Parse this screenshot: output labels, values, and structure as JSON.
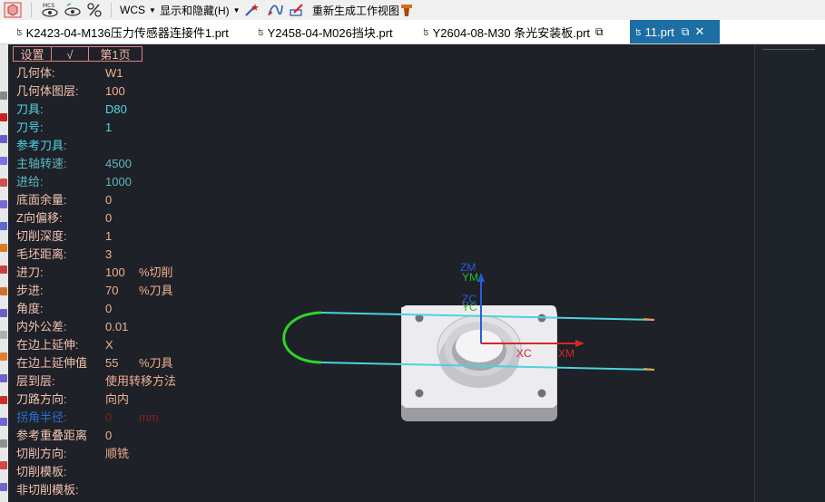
{
  "toolbar": {
    "wcs_label": "WCS",
    "show_hide_label": "显示和隐藏(H)",
    "regen_label": "重新生成工作视图"
  },
  "tabs": [
    {
      "label": "K2423-04-M136压力传感器连接件1.prt"
    },
    {
      "label": "Y2458-04-M026挡块.prt"
    },
    {
      "label": "Y2604-08-M30 条光安装板.prt"
    },
    {
      "label": "11.prt"
    }
  ],
  "panel": {
    "header": {
      "settings": "设置",
      "check": "√",
      "page": "第1页"
    },
    "rows": [
      {
        "label": "几何体:",
        "value": "W1",
        "unit": ""
      },
      {
        "label": "几何体图层:",
        "value": "100",
        "unit": ""
      },
      {
        "label": "刀具:",
        "value": "D80",
        "unit": ""
      },
      {
        "label": "刀号:",
        "value": "1",
        "unit": ""
      },
      {
        "label": "参考刀具:",
        "value": "",
        "unit": ""
      },
      {
        "label": "主轴转速:",
        "value": "4500",
        "unit": ""
      },
      {
        "label": "进给:",
        "value": "1000",
        "unit": ""
      },
      {
        "label": "底面余量:",
        "value": "0",
        "unit": ""
      },
      {
        "label": "Z向偏移:",
        "value": "0",
        "unit": ""
      },
      {
        "label": "切削深度:",
        "value": "1",
        "unit": ""
      },
      {
        "label": "毛坯距离:",
        "value": "3",
        "unit": ""
      },
      {
        "label": "进刀:",
        "value": "100",
        "unit": "%切削"
      },
      {
        "label": "步进:",
        "value": "70",
        "unit": "%刀具"
      },
      {
        "label": "角度:",
        "value": "0",
        "unit": ""
      },
      {
        "label": "内外公差:",
        "value": "0.01",
        "unit": ""
      },
      {
        "label": "在边上延伸:",
        "value": "X",
        "unit": ""
      },
      {
        "label": "在边上延伸值",
        "value": "55",
        "unit": "%刀具"
      },
      {
        "label": "层到层:",
        "value": "使用转移方法",
        "unit": ""
      },
      {
        "label": "刀路方向:",
        "value": "向内",
        "unit": ""
      },
      {
        "label": "拐角半径:",
        "value": "0",
        "unit": "mm"
      },
      {
        "label": "参考重叠距离",
        "value": "0",
        "unit": ""
      },
      {
        "label": "切削方向:",
        "value": "顺铣",
        "unit": ""
      },
      {
        "label": "切削模板:",
        "value": "",
        "unit": ""
      },
      {
        "label": "非切削模板:",
        "value": "",
        "unit": ""
      }
    ]
  },
  "viewport": {
    "axis_labels": {
      "zm": "ZM",
      "ym": "YM",
      "zc": "ZC",
      "yc": "YC",
      "xc": "XC",
      "xm": "XM"
    }
  },
  "colors": {
    "background": "#1e2127",
    "label_default": "#f2c2b0",
    "value_default": "#f0b090",
    "label_cyan": "#4fd6e6",
    "label_blue": "#2a6fd8",
    "dim_red": "#8b1d1d",
    "toolpath_cyan": "#4fd1dc",
    "toolpath_green": "#2bd52b",
    "active_tab": "#1c6ea4"
  }
}
